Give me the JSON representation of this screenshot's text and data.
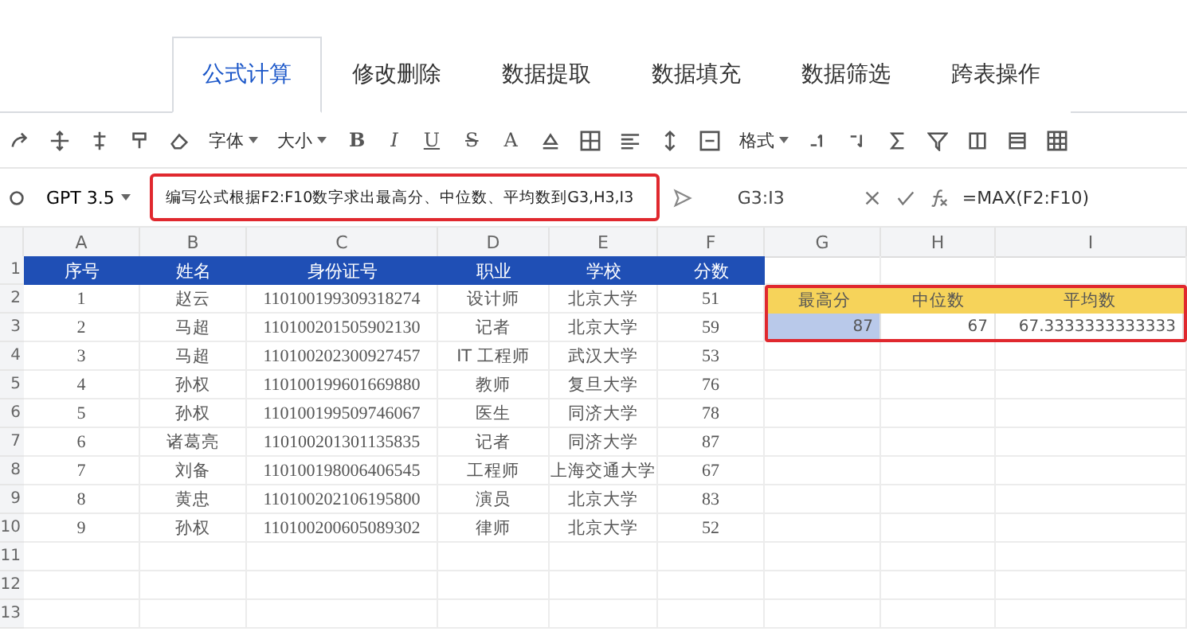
{
  "tabs": [
    {
      "label": "公式计算",
      "selected": true
    },
    {
      "label": "修改删除",
      "selected": false
    },
    {
      "label": "数据提取",
      "selected": false
    },
    {
      "label": "数据填充",
      "selected": false
    },
    {
      "label": "数据筛选",
      "selected": false
    },
    {
      "label": "跨表操作",
      "selected": false
    }
  ],
  "toolbar": [
    {
      "kind": "dropdown",
      "label": "字体"
    },
    {
      "kind": "dropdown",
      "label": "大小"
    },
    {
      "kind": "letter",
      "label": "B"
    },
    {
      "kind": "letter",
      "label": "I"
    },
    {
      "kind": "letter",
      "label": "U"
    },
    {
      "kind": "letter",
      "label": "S"
    },
    {
      "kind": "letter",
      "label": "A"
    },
    {
      "kind": "dropdown",
      "label": "格式"
    }
  ],
  "formula_bar": {
    "model": "GPT 3.5",
    "prompt": "编写公式根据F2:F10数字求出最高分、中位数、平均数到G3,H3,I3",
    "name_box": "G3:I3",
    "formula": "=MAX(F2:F10)"
  },
  "sheet": {
    "columns": [
      "A",
      "B",
      "C",
      "D",
      "E",
      "F",
      "G",
      "H",
      "I"
    ],
    "row_numbers": [
      "1",
      "2",
      "3",
      "4",
      "5",
      "6",
      "7",
      "8",
      "9",
      "10",
      "11",
      "12",
      "13"
    ],
    "header": [
      "序号",
      "姓名",
      "身份证号",
      "职业",
      "学校",
      "分数"
    ],
    "rows": [
      [
        "1",
        "赵云",
        "110100199309318274",
        "设计师",
        "北京大学",
        "51"
      ],
      [
        "2",
        "马超",
        "110100201505902130",
        "记者",
        "北京大学",
        "59"
      ],
      [
        "3",
        "马超",
        "110100202300927457",
        "IT 工程师",
        "武汉大学",
        "53"
      ],
      [
        "4",
        "孙权",
        "110100199601669880",
        "教师",
        "复旦大学",
        "76"
      ],
      [
        "5",
        "孙权",
        "110100199509746067",
        "医生",
        "同济大学",
        "78"
      ],
      [
        "6",
        "诸葛亮",
        "110100201301135835",
        "记者",
        "同济大学",
        "87"
      ],
      [
        "7",
        "刘备",
        "110100198006406545",
        "工程师",
        "上海交通大学",
        "67"
      ],
      [
        "8",
        "黄忠",
        "110100202106195800",
        "演员",
        "北京大学",
        "83"
      ],
      [
        "9",
        "孙权",
        "110100200605089302",
        "律师",
        "北京大学",
        "52"
      ]
    ],
    "result_labels": [
      "最高分",
      "中位数",
      "平均数"
    ],
    "result_values": [
      {
        "text": "87",
        "selected": true
      },
      {
        "text": "67",
        "selected": false
      },
      {
        "text": "67.3333333333333",
        "selected": false
      }
    ]
  }
}
